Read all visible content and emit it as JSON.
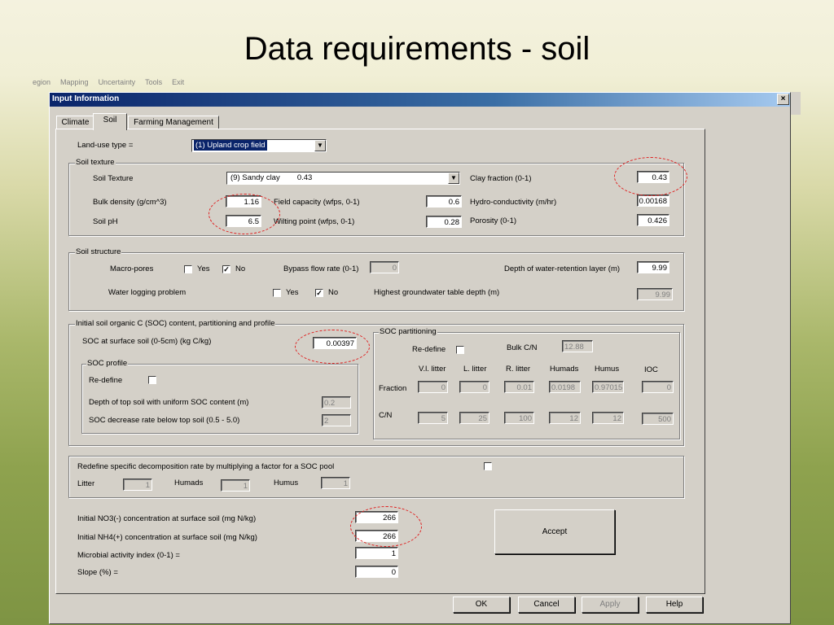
{
  "slide_title": "Data requirements - soil",
  "menu_items": [
    "egion",
    "Mapping",
    "Uncertainty",
    "Tools",
    "Exit"
  ],
  "dialog": {
    "title": "Input Information",
    "close": "×"
  },
  "tabs": [
    "Climate",
    "Soil",
    "Farming Management"
  ],
  "landuse": {
    "label": "Land-use type =",
    "value": "(1) Upland crop field"
  },
  "soil_texture": {
    "group": "Soil texture",
    "texture_label": "Soil Texture",
    "texture_value": "(9) Sandy clay        0.43",
    "bulk_label": "Bulk density (g/cm^3)",
    "bulk_value": "1.16",
    "ph_label": "Soil pH",
    "ph_value": "6.5",
    "field_label": "Field capacity (wfps, 0-1)",
    "field_value": "0.6",
    "wilt_label": "Wilting point (wfps, 0-1)",
    "wilt_value": "0.28",
    "clay_label": "Clay fraction (0-1)",
    "clay_value": "0.43",
    "hydro_label": "Hydro-conductivity (m/hr)",
    "hydro_value": "0.00168",
    "poro_label": "Porosity (0-1)",
    "poro_value": "0.426"
  },
  "soil_structure": {
    "group": "Soil structure",
    "macro_label": "Macro-pores",
    "yes": "Yes",
    "no": "No",
    "bypass_label": "Bypass flow rate (0-1)",
    "bypass_value": "0",
    "depth_label": "Depth of water-retention layer (m)",
    "depth_value": "9.99",
    "waterlog_label": "Water logging problem",
    "gw_label": "Highest groundwater table depth (m)",
    "gw_value": "9.99",
    "check_mark": "✓"
  },
  "soc": {
    "group": "Initial soil organic C (SOC) content, partitioning and profile",
    "surface_label": "SOC at surface soil (0-5cm) (kg C/kg)",
    "surface_value": "0.00397",
    "profile_group": "SOC profile",
    "redefine_label": "Re-define",
    "depth_label": "Depth of top soil with uniform SOC content (m)",
    "depth_value": "0.2",
    "rate_label": "SOC decrease rate below top soil (0.5 - 5.0)",
    "rate_value": "2",
    "part_group": "SOC partitioning",
    "part_redefine": "Re-define",
    "bulk_cn_label": "Bulk C/N",
    "bulk_cn_value": "12.88",
    "columns": [
      "V.l. litter",
      "L. litter",
      "R. litter",
      "Humads",
      "Humus",
      "IOC"
    ],
    "fraction_label": "Fraction",
    "fraction_values": [
      "0",
      "0",
      "0.01",
      "0.0198",
      "0.97015",
      "0"
    ],
    "cn_label": "C/N",
    "cn_values": [
      "5",
      "25",
      "100",
      "12",
      "12",
      "500"
    ]
  },
  "decomp": {
    "label": "Redefine specific decomposition rate by multiplying a factor for a SOC pool",
    "litter_label": "Litter",
    "litter_value": "1",
    "humads_label": "Humads",
    "humads_value": "1",
    "humus_label": "Humus",
    "humus_value": "1"
  },
  "bottom": {
    "no3_label": "Initial NO3(-) concentration at surface soil (mg N/kg)",
    "no3_value": "266",
    "nh4_label": "Initial NH4(+) concentration at surface soil (mg N/kg)",
    "nh4_value": "266",
    "microbial_label": "Microbial activity index (0-1) =",
    "microbial_value": "1",
    "slope_label": "Slope (%) =",
    "slope_value": "0",
    "accept": "Accept"
  },
  "buttons": {
    "ok": "OK",
    "cancel": "Cancel",
    "apply": "Apply",
    "help": "Help"
  },
  "icons": {
    "combo_arrow": "▼"
  },
  "colors": {
    "titlebar": "#0a246a",
    "highlight_ellipse": "#e02020",
    "dialog_face": "#d4d0c8"
  }
}
